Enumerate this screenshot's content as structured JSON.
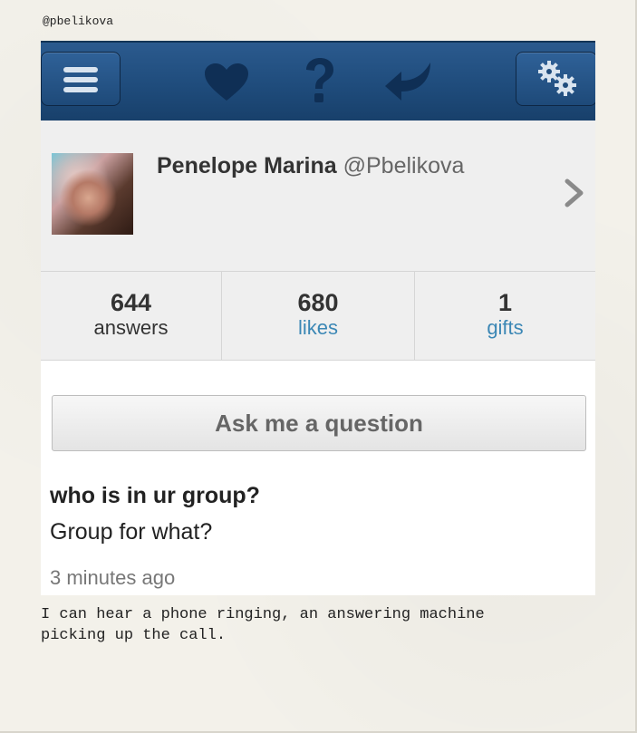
{
  "photo": {
    "handle": "@pbelikova",
    "caption": "I can hear a phone ringing, an answering machine\npicking up the call."
  },
  "navbar": {
    "menu_icon": "hamburger-menu-icon",
    "like_icon": "heart-icon",
    "help_icon": "question-mark-icon",
    "reply_icon": "reply-arrow-icon",
    "settings_icon": "gears-icon"
  },
  "profile": {
    "name": "Penelope Marina",
    "username": "@Pbelikova",
    "chevron_icon": "chevron-right-icon"
  },
  "stats": [
    {
      "count": "644",
      "label": "answers",
      "label_color": "#333333"
    },
    {
      "count": "680",
      "label": "likes",
      "label_color": "#3b87b5"
    },
    {
      "count": "1",
      "label": "gifts",
      "label_color": "#3b87b5"
    }
  ],
  "ask_button": "Ask me a question",
  "post": {
    "question": "who is in ur group?",
    "answer": "Group for what?",
    "time": "3 minutes ago"
  }
}
